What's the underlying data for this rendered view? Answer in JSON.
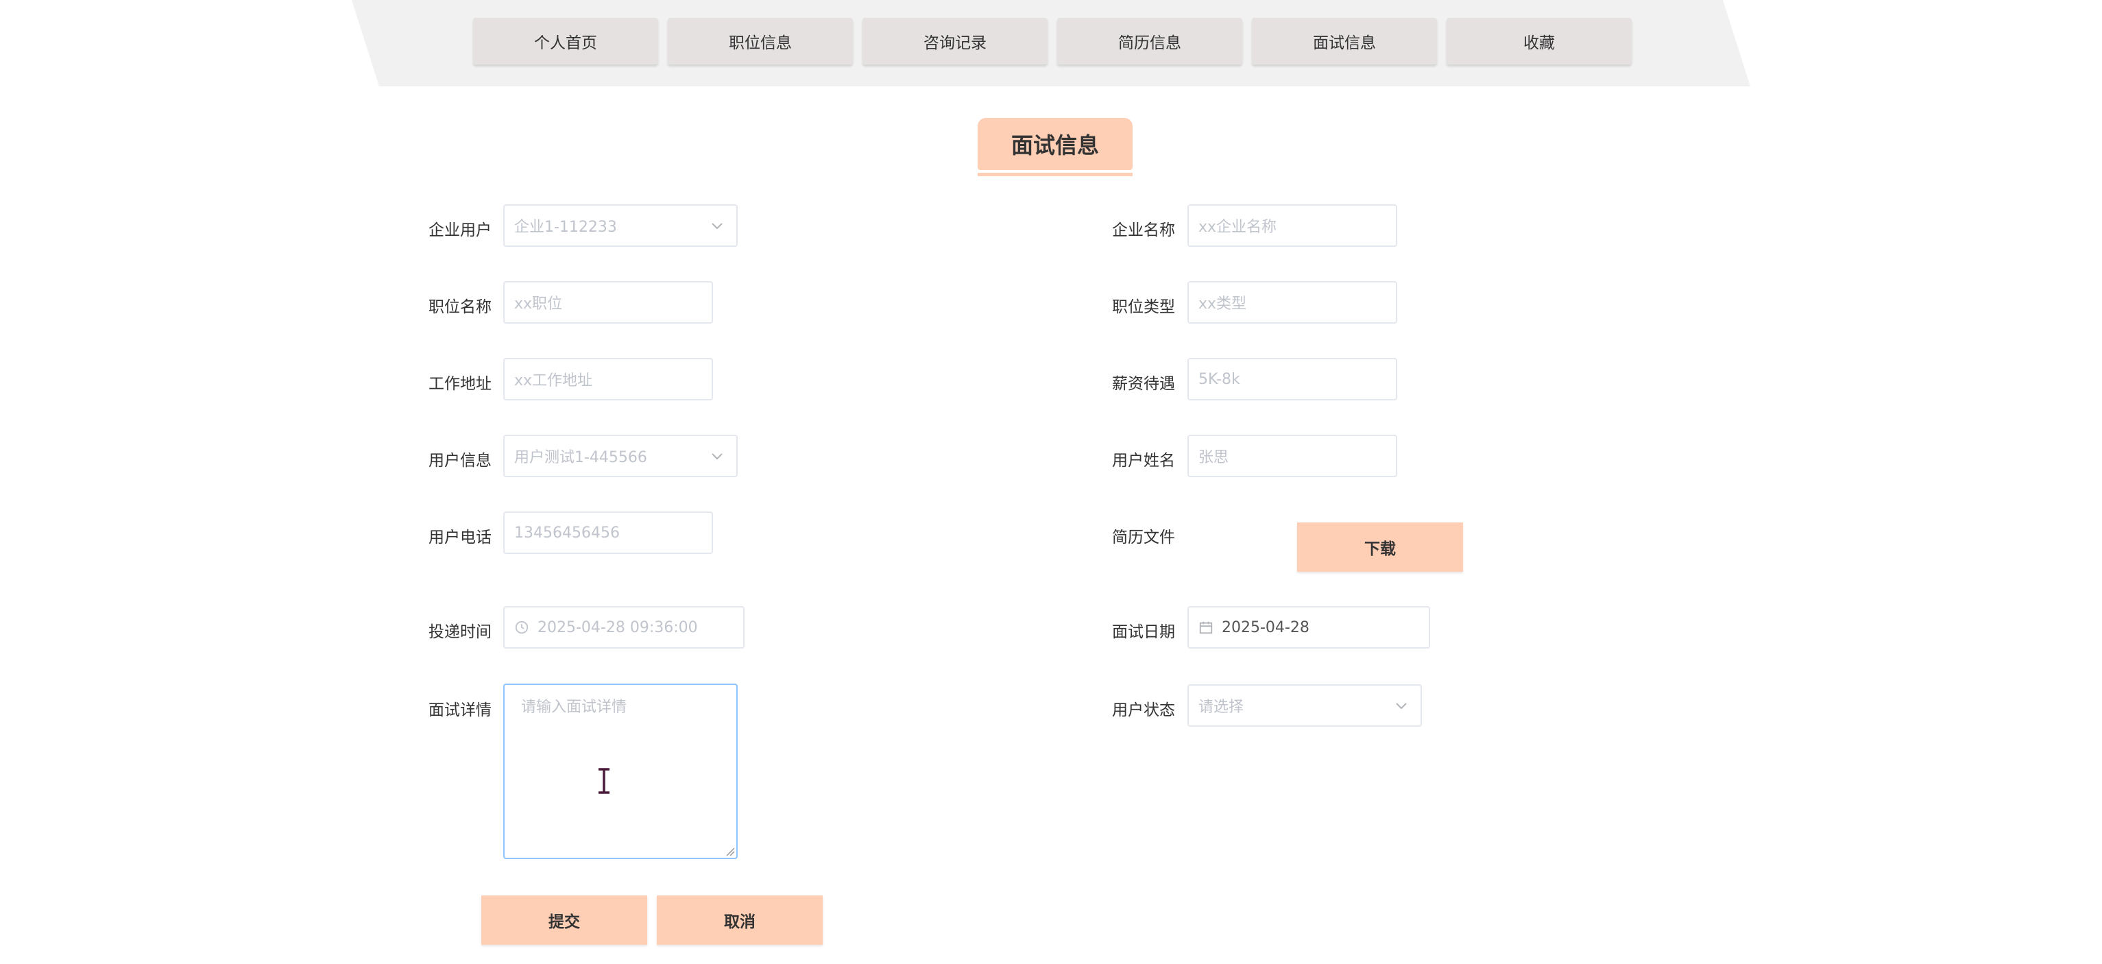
{
  "nav": {
    "items": [
      "个人首页",
      "职位信息",
      "咨询记录",
      "简历信息",
      "面试信息",
      "收藏"
    ]
  },
  "page_title": "面试信息",
  "form": {
    "company_user": {
      "label": "企业用户",
      "placeholder": "企业1-112233"
    },
    "company_name": {
      "label": "企业名称",
      "placeholder": "xx企业名称"
    },
    "position_name": {
      "label": "职位名称",
      "placeholder": "xx职位"
    },
    "position_type": {
      "label": "职位类型",
      "placeholder": "xx类型"
    },
    "work_address": {
      "label": "工作地址",
      "placeholder": "xx工作地址"
    },
    "salary": {
      "label": "薪资待遇",
      "placeholder": "5K-8k"
    },
    "user_info": {
      "label": "用户信息",
      "placeholder": "用户测试1-445566"
    },
    "user_name": {
      "label": "用户姓名",
      "placeholder": "张思"
    },
    "user_phone": {
      "label": "用户电话",
      "placeholder": "13456456456"
    },
    "resume_file": {
      "label": "简历文件",
      "download_label": "下载"
    },
    "delivery_time": {
      "label": "投递时间",
      "placeholder": "2025-04-28 09:36:00"
    },
    "interview_date": {
      "label": "面试日期",
      "value": "2025-04-28"
    },
    "interview_detail": {
      "label": "面试详情",
      "placeholder": "请输入面试详情"
    },
    "user_status": {
      "label": "用户状态",
      "placeholder": "请选择"
    }
  },
  "actions": {
    "submit": "提交",
    "cancel": "取消"
  },
  "colors": {
    "accent": "#ffcfb5",
    "nav_button": "#e5e1e1",
    "nav_band": "#f2f1f1",
    "focus_border": "#8cc5ff"
  }
}
